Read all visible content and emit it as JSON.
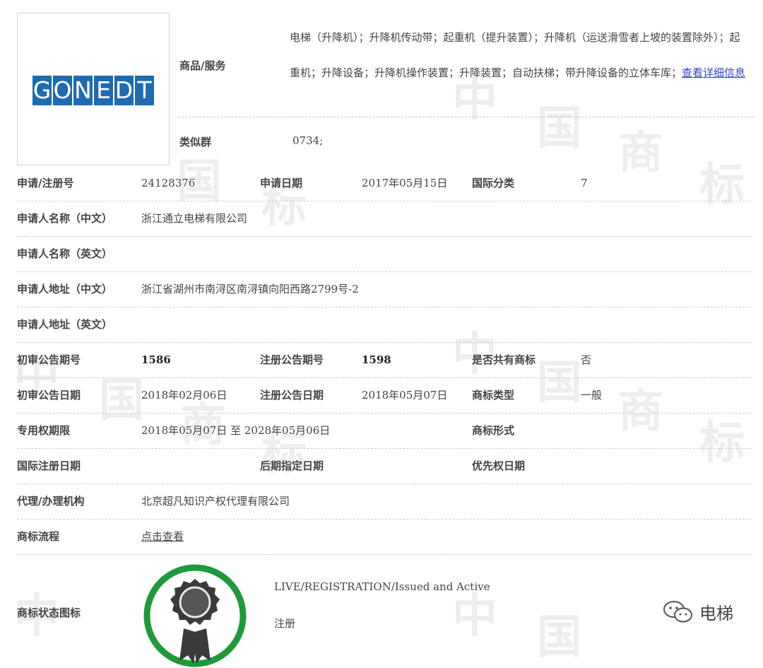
{
  "watermark": [
    "中",
    "国",
    "商",
    "标"
  ],
  "logo": {
    "letters": [
      "G",
      "O",
      "N",
      "E",
      "D",
      "T"
    ],
    "brand_color": "#1f6bb0"
  },
  "goods": {
    "label": "商品/服务",
    "text": "电梯（升降机）；升降机传动带；起重机（提升装置）；升降机（运送滑雪者上坡的装置除外）；起重机；升降设备；升降机操作装置；升降装置；自动扶梯；带升降设备的立体车库；",
    "detail_link": "查看详细信息",
    "similar_label": "类似群",
    "similar_value": "0734;"
  },
  "fields": {
    "reg_no": {
      "label": "申请/注册号",
      "value": "24128376"
    },
    "app_date": {
      "label": "申请日期",
      "value": "2017年05月15日"
    },
    "intl_class": {
      "label": "国际分类",
      "value": "7"
    },
    "applicant_cn": {
      "label": "申请人名称（中文）",
      "value": "浙江通立电梯有限公司"
    },
    "applicant_en": {
      "label": "申请人名称（英文）",
      "value": ""
    },
    "address_cn": {
      "label": "申请人地址（中文）",
      "value": "浙江省湖州市南浔区南浔镇向阳西路2799号-2"
    },
    "address_en": {
      "label": "申请人地址（英文）",
      "value": ""
    },
    "prelim_issue": {
      "label": "初审公告期号",
      "value": "1586"
    },
    "reg_issue": {
      "label": "注册公告期号",
      "value": "1598"
    },
    "shared": {
      "label": "是否共有商标",
      "value": "否"
    },
    "prelim_date": {
      "label": "初审公告日期",
      "value": "2018年02月06日"
    },
    "reg_date": {
      "label": "注册公告日期",
      "value": "2018年05月07日"
    },
    "tm_type": {
      "label": "商标类型",
      "value": "一般"
    },
    "exclusive": {
      "label": "专用权期限",
      "value": "2018年05月07日 至 2028年05月06日"
    },
    "tm_form": {
      "label": "商标形式",
      "value": ""
    },
    "intl_reg_date": {
      "label": "国际注册日期",
      "value": ""
    },
    "later_date": {
      "label": "后期指定日期",
      "value": ""
    },
    "priority_date": {
      "label": "优先权日期",
      "value": ""
    },
    "agent": {
      "label": "代理/办理机构",
      "value": "北京超凡知识产权代理有限公司"
    },
    "process": {
      "label": "商标流程",
      "value": "点击查看"
    }
  },
  "status": {
    "label": "商标状态图标",
    "line1": "LIVE/REGISTRATION/Issued and Active",
    "line2": "注册",
    "ring_color": "#1e9a3c"
  },
  "wechat": {
    "text": "电梯"
  }
}
